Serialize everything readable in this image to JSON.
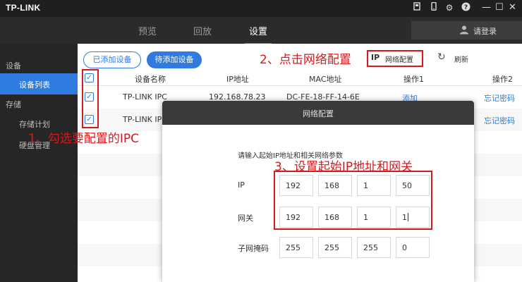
{
  "app": {
    "logo": "TP-LINK",
    "title_icons": [
      "record-icon",
      "phone-icon",
      "gear-icon",
      "help-icon"
    ],
    "window_controls": [
      "—",
      "☐",
      "✕"
    ]
  },
  "nav": {
    "tabs": [
      {
        "label": "预览",
        "active": false
      },
      {
        "label": "回放",
        "active": false
      },
      {
        "label": "设置",
        "active": true
      }
    ],
    "login_label": "请登录"
  },
  "sidebar": {
    "groups": [
      {
        "label": "设备",
        "items": [
          {
            "label": "设备列表",
            "active": true
          }
        ]
      },
      {
        "label": "存储",
        "items": [
          {
            "label": "存储计划",
            "active": false
          },
          {
            "label": "硬盘管理",
            "active": false
          }
        ]
      }
    ]
  },
  "main": {
    "tab_added": "已添加设备",
    "tab_pending": "待添加设备",
    "toolbar_ip": "IP",
    "toolbar_netcfg": "网络配置",
    "refresh_label": "刷新",
    "columns": [
      "设备名称",
      "IP地址",
      "MAC地址",
      "操作1",
      "操作2"
    ],
    "rows": [
      {
        "name": "TP-LINK IPC",
        "ip": "192.168.78.23",
        "mac": "DC-FE-18-FF-14-6E",
        "op1": "添加",
        "op2": "忘记密码",
        "checked": true
      },
      {
        "name": "TP-LINK IP",
        "ip": "",
        "mac": "",
        "op1": "",
        "op2": "忘记密码",
        "checked": true
      }
    ]
  },
  "annotations": {
    "step1": "1、勾选要配置的IPC",
    "step2": "2、点击网络配置",
    "step3": "3、设置起始IP地址和网关"
  },
  "dialog": {
    "title": "网络配置",
    "hint": "请输入起始IP地址和相关网络参数",
    "ip_label": "IP",
    "ip": [
      "192",
      "168",
      "1",
      "50"
    ],
    "gateway_label": "网关",
    "gateway": [
      "192",
      "168",
      "1",
      "1"
    ],
    "mask_label": "子网掩码",
    "mask": [
      "255",
      "255",
      "255",
      "0"
    ]
  },
  "colors": {
    "accent": "#2f7be0",
    "annotation_red": "#d7191c",
    "titlebar": "#1f1f1f",
    "sidebar": "#262626"
  }
}
